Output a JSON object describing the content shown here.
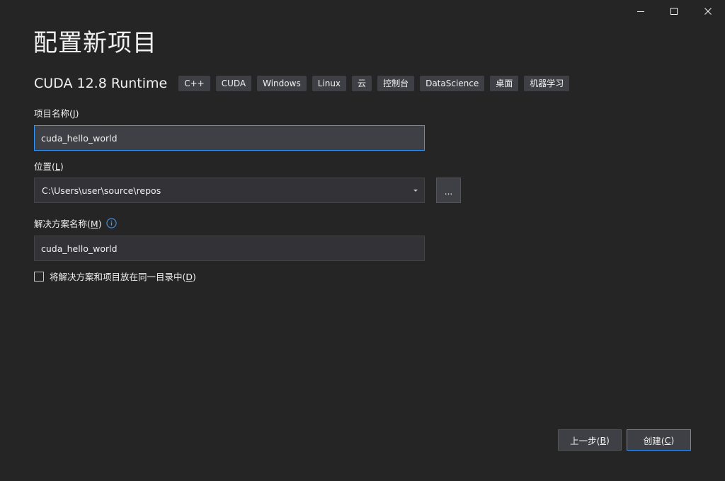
{
  "window": {
    "title": "配置新项目"
  },
  "template": {
    "name": "CUDA 12.8 Runtime",
    "tags": [
      "C++",
      "CUDA",
      "Windows",
      "Linux",
      "云",
      "控制台",
      "DataScience",
      "桌面",
      "机器学习"
    ]
  },
  "fields": {
    "project_name": {
      "label": "项目名称(",
      "accel": "J",
      "label_end": ")",
      "value": "cuda_hello_world"
    },
    "location": {
      "label": "位置(",
      "accel": "L",
      "label_end": ")",
      "value": "C:\\Users\\user\\source\\repos",
      "browse_label": "..."
    },
    "solution_name": {
      "label": "解决方案名称(",
      "accel": "M",
      "label_end": ")",
      "value": "cuda_hello_world"
    },
    "same_dir": {
      "label": "将解决方案和项目放在同一目录中(",
      "accel": "D",
      "label_end": ")",
      "checked": false
    }
  },
  "buttons": {
    "back": {
      "label": "上一步(",
      "accel": "B",
      "label_end": ")"
    },
    "create": {
      "label": "创建(",
      "accel": "C",
      "label_end": ")"
    }
  },
  "colors": {
    "background": "#252526",
    "accent": "#3399ff",
    "input_bg": "#333337",
    "tag_bg": "#3f3f46"
  }
}
